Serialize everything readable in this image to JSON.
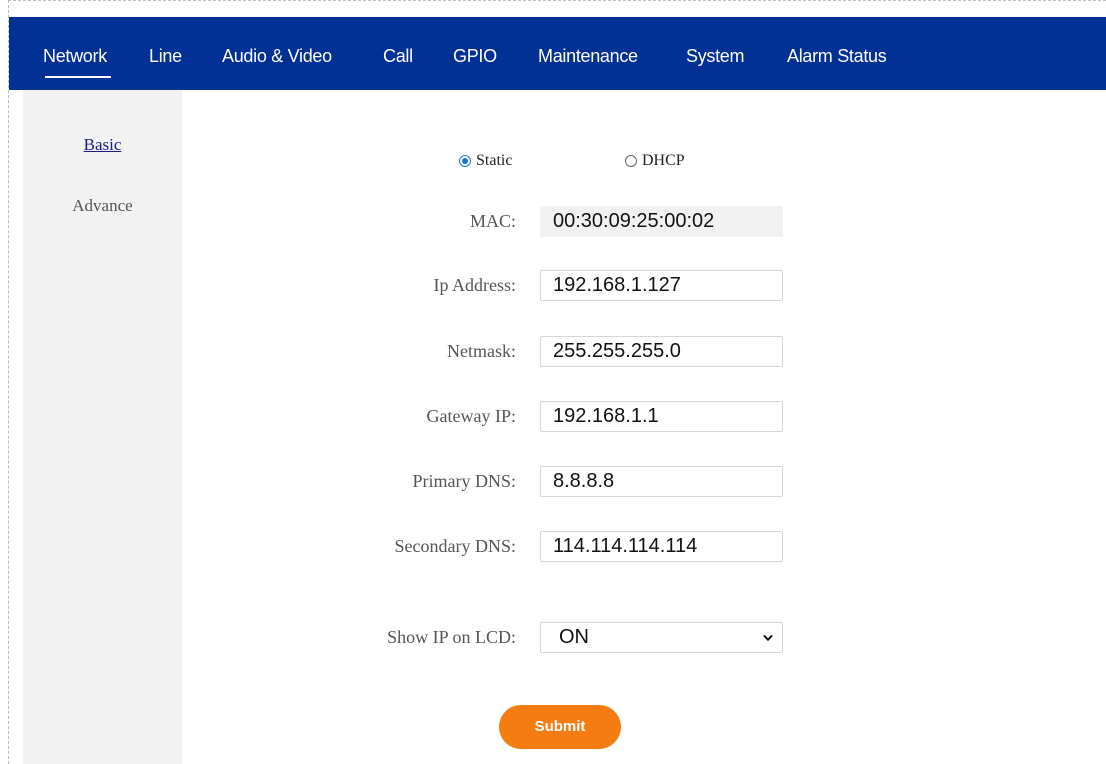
{
  "colors": {
    "nav_bg": "#013195",
    "sidebar_bg": "#f2f2f2",
    "submit_bg": "#f47c10",
    "radio_accent": "#1a73e8",
    "label_text": "#555555",
    "active_link": "#1a1a8c"
  },
  "topnav": {
    "items": [
      {
        "label": "Network",
        "active": true
      },
      {
        "label": "Line",
        "active": false
      },
      {
        "label": "Audio & Video",
        "active": false
      },
      {
        "label": "Call",
        "active": false
      },
      {
        "label": "GPIO",
        "active": false
      },
      {
        "label": "Maintenance",
        "active": false
      },
      {
        "label": "System",
        "active": false
      },
      {
        "label": "Alarm Status",
        "active": false
      }
    ]
  },
  "sidebar": {
    "items": [
      {
        "label": "Basic",
        "active": true
      },
      {
        "label": "Advance",
        "active": false
      }
    ]
  },
  "mode": {
    "options": [
      {
        "label": "Static",
        "checked": true
      },
      {
        "label": "DHCP",
        "checked": false
      }
    ]
  },
  "form": {
    "mac": {
      "label": "MAC:",
      "value": "00:30:09:25:00:02"
    },
    "ip_address": {
      "label": "Ip Address:",
      "value": "192.168.1.127"
    },
    "netmask": {
      "label": "Netmask:",
      "value": "255.255.255.0"
    },
    "gateway_ip": {
      "label": "Gateway IP:",
      "value": "192.168.1.1"
    },
    "primary_dns": {
      "label": "Primary DNS:",
      "value": "8.8.8.8"
    },
    "secondary_dns": {
      "label": "Secondary DNS:",
      "value": "114.114.114.114"
    },
    "show_ip_lcd": {
      "label": "Show IP on LCD:",
      "value": "ON"
    }
  },
  "submit": {
    "label": "Submit"
  }
}
